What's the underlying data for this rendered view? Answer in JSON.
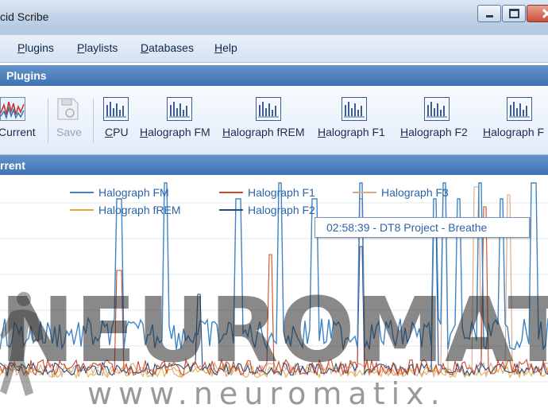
{
  "window": {
    "title": "cid Scribe"
  },
  "menu": [
    {
      "label": "Plugins",
      "accel": "P",
      "rest": "lugins"
    },
    {
      "label": "Playlists",
      "accel": "P",
      "rest": "laylists"
    },
    {
      "label": "Databases",
      "accel": "D",
      "rest": "atabases"
    },
    {
      "label": "Help",
      "accel": "H",
      "rest": "elp"
    }
  ],
  "plugins_header": "Plugins",
  "toolbar": {
    "items": [
      {
        "label": "Current",
        "accel": "",
        "rest": "Current",
        "icon": "waveform-icon",
        "enabled": true
      },
      {
        "label": "Save",
        "accel": "",
        "rest": "Save",
        "icon": "save-icon",
        "enabled": false
      },
      {
        "label": "CPU",
        "accel": "C",
        "rest": "PU",
        "icon": "chart-icon",
        "enabled": true
      },
      {
        "label": "Halograph FM",
        "accel": "H",
        "rest": "alograph FM",
        "icon": "chart-icon",
        "enabled": true
      },
      {
        "label": "Halograph fREM",
        "accel": "H",
        "rest": "alograph fREM",
        "icon": "chart-icon",
        "enabled": true
      },
      {
        "label": "Halograph F1",
        "accel": "H",
        "rest": "alograph F1",
        "icon": "chart-icon",
        "enabled": true
      },
      {
        "label": "Halograph F2",
        "accel": "H",
        "rest": "alograph F2",
        "icon": "chart-icon",
        "enabled": true
      },
      {
        "label": "Halograph F",
        "accel": "H",
        "rest": "alograph F",
        "icon": "chart-icon",
        "enabled": true
      }
    ]
  },
  "current_header": "rrent",
  "chart_data": {
    "type": "line",
    "series": [
      {
        "name": "Halograph FM",
        "color": "#3d85c6"
      },
      {
        "name": "Halograph F1",
        "color": "#cc4a2a"
      },
      {
        "name": "Halograph F3",
        "color": "#d8a88a"
      },
      {
        "name": "Halograph fREM",
        "color": "#e5a93a"
      },
      {
        "name": "Halograph F2",
        "color": "#1f4e8c"
      }
    ],
    "grid": true,
    "legend_position": "top"
  },
  "tooltip": "02:58:39 - DT8 Project - Breathe",
  "watermark": {
    "logo": "NEUROMATIX",
    "url": "www.neuromatix."
  },
  "colors": {
    "accent": "#3e72b1",
    "menu_bg": "#d4e2f2"
  }
}
